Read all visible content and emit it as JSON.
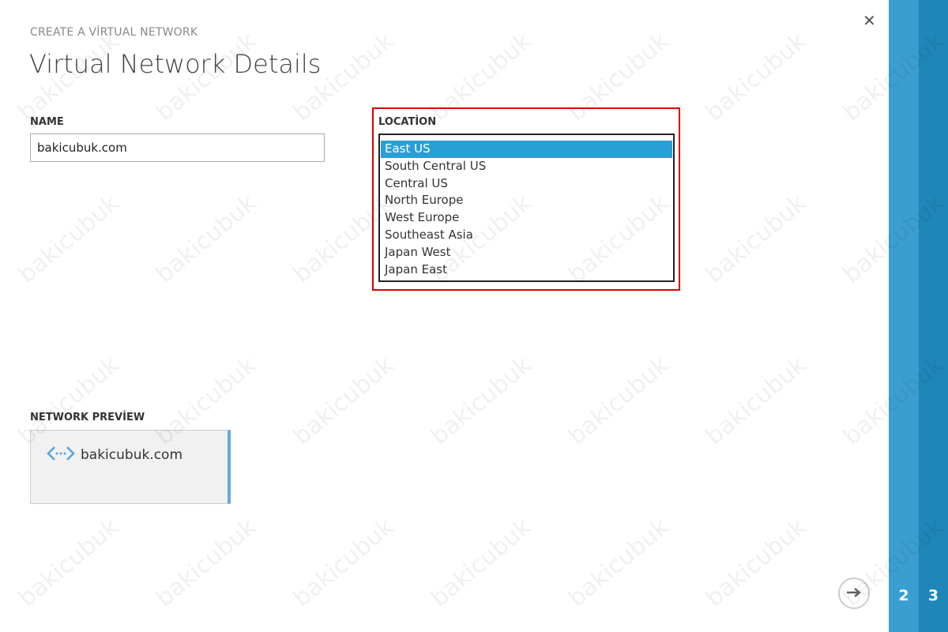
{
  "header": {
    "subtitle": "CREATE A VİRTUAL NETWORK",
    "title": "Virtual Network Details",
    "close_icon": "close-icon"
  },
  "name": {
    "label": "NAME",
    "value": "bakicubuk.com"
  },
  "location": {
    "label": "LOCATİON",
    "selected": "East US",
    "options": [
      "East US",
      "South Central US",
      "Central US",
      "North Europe",
      "West Europe",
      "Southeast Asia",
      "Japan West",
      "Japan East"
    ]
  },
  "preview": {
    "label": "NETWORK PREVİEW",
    "network_name": "bakicubuk.com",
    "icon": "virtual-network-icon"
  },
  "footer": {
    "next_icon": "arrow-right-icon",
    "steps": [
      "2",
      "3"
    ]
  },
  "watermark": "bakicubuk",
  "colors": {
    "selected": "#2a9fd6",
    "highlight": "#dd0000",
    "step2": "#3a9fd0",
    "step3": "#1f86b9",
    "accent": "#6aa7d9"
  }
}
